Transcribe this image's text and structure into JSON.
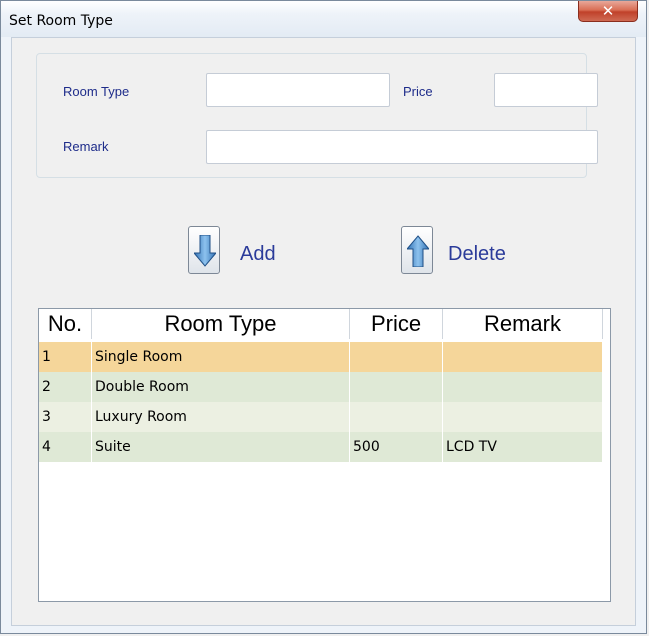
{
  "window": {
    "title": "Set Room Type",
    "close_glyph": "✕"
  },
  "form": {
    "room_type_label": "Room Type",
    "room_type_value": "",
    "price_label": "Price",
    "price_value": "",
    "remark_label": "Remark",
    "remark_value": ""
  },
  "actions": {
    "add_label": "Add",
    "add_icon": "down-arrow-icon",
    "delete_label": "Delete",
    "delete_icon": "up-arrow-icon"
  },
  "table": {
    "columns": [
      "No.",
      "Room Type",
      "Price",
      "Remark"
    ],
    "rows": [
      {
        "no": "1",
        "room_type": "Single Room",
        "price": "",
        "remark": ""
      },
      {
        "no": "2",
        "room_type": "Double Room",
        "price": "",
        "remark": ""
      },
      {
        "no": "3",
        "room_type": "Luxury Room",
        "price": "",
        "remark": ""
      },
      {
        "no": "4",
        "room_type": "Suite",
        "price": "500",
        "remark": "LCD TV"
      }
    ],
    "selected_row_color": "#f5d69a",
    "even_row_color": "#dfe9d6",
    "odd_row_color": "#ecf0e2"
  }
}
